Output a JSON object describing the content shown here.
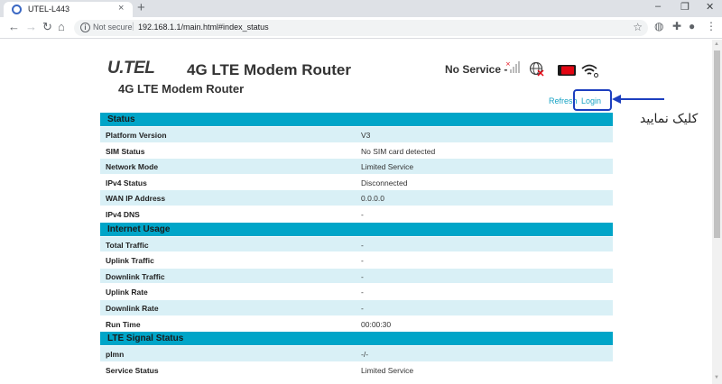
{
  "browser": {
    "tab_title": "UTEL-L443",
    "tab_close": "×",
    "new_tab": "+",
    "minimize": "–",
    "restore": "❐",
    "close": "✕",
    "not_secure": "Not secure",
    "url": "192.168.1.1/main.html#index_status"
  },
  "header": {
    "logo": "U.TEL",
    "product_title": "4G LTE Modem Router",
    "product_subtitle": "4G LTE Modem Router",
    "network_status": "No Service  -",
    "refresh_label": "Refresh",
    "login_label": "Login",
    "annotation": "کلیک نمایید"
  },
  "sections": [
    {
      "title": "Status",
      "rows": [
        {
          "key": "Platform Version",
          "value": "V3"
        },
        {
          "key": "SIM Status",
          "value": "No SIM card detected"
        },
        {
          "key": "Network Mode",
          "value": "Limited Service"
        },
        {
          "key": "IPv4 Status",
          "value": "Disconnected"
        },
        {
          "key": "WAN IP Address",
          "value": "0.0.0.0"
        },
        {
          "key": "IPv4 DNS",
          "value": "-"
        }
      ]
    },
    {
      "title": "Internet Usage",
      "rows": [
        {
          "key": "Total Traffic",
          "value": "-"
        },
        {
          "key": "Uplink Traffic",
          "value": "-"
        },
        {
          "key": "Downlink Traffic",
          "value": "-"
        },
        {
          "key": "Uplink Rate",
          "value": "-"
        },
        {
          "key": "Downlink Rate",
          "value": "-"
        },
        {
          "key": "Run Time",
          "value": "00:00:30"
        }
      ]
    },
    {
      "title": "LTE Signal Status",
      "rows": [
        {
          "key": "plmn",
          "value": "-/-"
        },
        {
          "key": "Service Status",
          "value": "Limited Service"
        }
      ]
    }
  ],
  "colors": {
    "section_header": "#00a5c8",
    "row_alt": "#d9f0f6",
    "link": "#17a2c4",
    "highlight_box": "#1d3fbf"
  }
}
